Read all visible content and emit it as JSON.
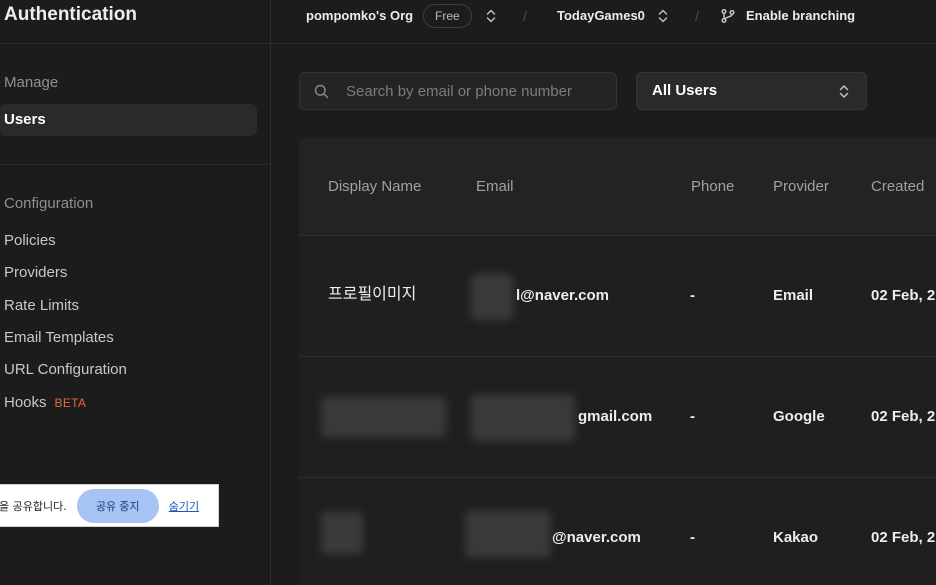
{
  "sidebar": {
    "title": "Authentication",
    "manage_label": "Manage",
    "users_label": "Users",
    "configuration_label": "Configuration",
    "items": [
      {
        "label": "Policies"
      },
      {
        "label": "Providers"
      },
      {
        "label": "Rate Limits"
      },
      {
        "label": "Email Templates"
      },
      {
        "label": "URL Configuration"
      },
      {
        "label": "Hooks",
        "badge": "BETA"
      }
    ]
  },
  "topbar": {
    "org": "pompomko's Org",
    "plan": "Free",
    "project": "TodayGames0",
    "branching": "Enable branching",
    "separator": "/"
  },
  "toolbar": {
    "search_placeholder": "Search by email or phone number",
    "filter_value": "All Users"
  },
  "table": {
    "headers": {
      "display_name": "Display Name",
      "email": "Email",
      "phone": "Phone",
      "provider": "Provider",
      "created": "Created"
    },
    "rows": [
      {
        "display_name": "프로필이미지",
        "email_visible": "l@naver.com",
        "phone": "-",
        "provider": "Email",
        "created": "02 Feb, 2"
      },
      {
        "display_name": "",
        "email_visible": "gmail.com",
        "phone": "-",
        "provider": "Google",
        "created": "02 Feb, 2"
      },
      {
        "display_name": "",
        "email_visible": "@naver.com",
        "phone": "-",
        "provider": "Kakao",
        "created": "02 Feb, 2"
      }
    ]
  },
  "sharebar": {
    "text": "을 공유합니다.",
    "stop_label": "공유 중지",
    "hide_label": "숨기기"
  },
  "colors": {
    "background": "#1c1c1c",
    "beta_badge": "#e5683a",
    "share_button": "#a7c3f4"
  }
}
